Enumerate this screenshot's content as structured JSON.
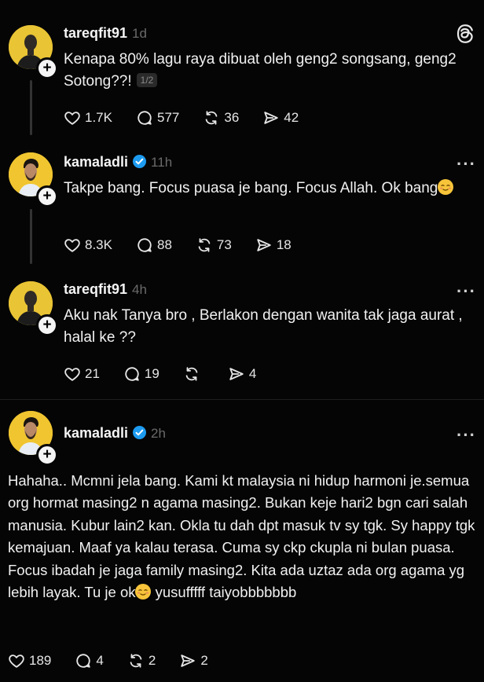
{
  "posts": [
    {
      "username": "tareqfit91",
      "time": "1d",
      "verified": false,
      "text": "Kenapa 80% lagu raya dibuat oleh geng2 songsang, geng2 Sotong??!",
      "page_badge": "1/2",
      "likes": "1.7K",
      "replies": "577",
      "reposts": "36",
      "shares": "42"
    },
    {
      "username": "kamaladli",
      "time": "11h",
      "verified": true,
      "text": "Takpe bang. Focus puasa je bang. Focus Allah. Ok bang",
      "emoji": "relieved-face",
      "likes": "8.3K",
      "replies": "88",
      "reposts": "73",
      "shares": "18"
    },
    {
      "username": "tareqfit91",
      "time": "4h",
      "verified": false,
      "text": "Aku nak Tanya bro , Berlakon dengan wanita tak jaga aurat , halal ke ??",
      "likes": "21",
      "replies": "19",
      "reposts": "",
      "shares": "4"
    },
    {
      "username": "kamaladli",
      "time": "2h",
      "verified": true,
      "text": "Hahaha.. Mcmni jela bang. Kami kt malaysia ni hidup harmoni je.semua org hormat masing2 n agama masing2. Bukan keje hari2 bgn cari salah manusia. Kubur lain2 kan. Okla tu dah dpt masuk tv sy tgk. Sy happy tgk kemajuan. Maaf ya kalau terasa. Cuma sy ckp ckupla ni bulan puasa. Focus ibadah je jaga family masing2. Kita ada uztaz ada org agama yg lebih layak. Tu je ok",
      "text_tail": " yusufffff taiyobbbbbbb",
      "emoji": "relieved-face",
      "likes": "189",
      "replies": "4",
      "reposts": "2",
      "shares": "2"
    }
  ],
  "icons": {
    "brand": "threads-logo-icon",
    "more": "more-options-icon",
    "like": "heart-icon",
    "reply": "comment-icon",
    "repost": "repost-icon",
    "share": "share-icon",
    "verified": "verified-badge-icon",
    "follow": "follow-plus-icon"
  },
  "colors": {
    "background": "#050505",
    "text": "#f3f3f3",
    "muted": "#6a6a6a",
    "verified": "#1d9bf0",
    "avatar_bg": "#e8c23a"
  }
}
